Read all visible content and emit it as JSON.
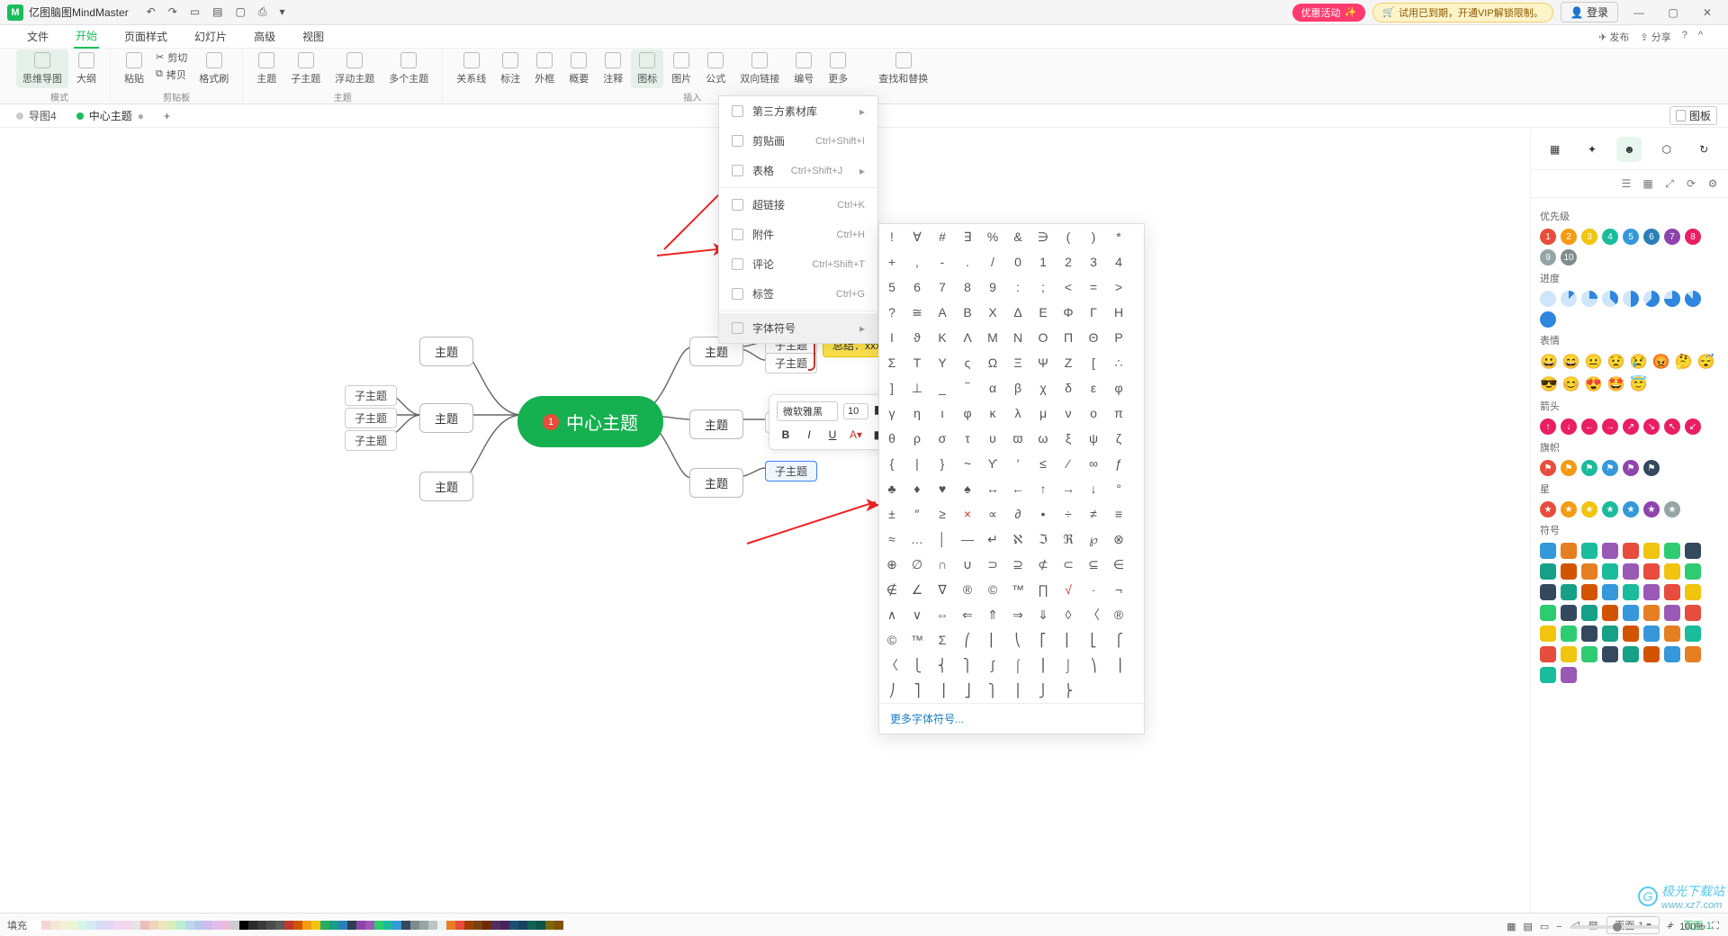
{
  "app": {
    "title": "亿图脑图MindMaster"
  },
  "titlebar": {
    "promo": "优惠活动",
    "vip": "试用已到期，开通VIP解锁限制。",
    "login": "登录"
  },
  "menu": {
    "items": [
      "文件",
      "开始",
      "页面样式",
      "幻灯片",
      "高级",
      "视图"
    ],
    "active": 1,
    "right": {
      "publish": "发布",
      "share": "分享"
    }
  },
  "ribbon": {
    "btns": [
      "思维导图",
      "大纲",
      "粘贴",
      "剪切",
      "拷贝",
      "格式刷",
      "主题",
      "子主题",
      "浮动主题",
      "多个主题",
      "关系线",
      "标注",
      "外框",
      "概要",
      "注释",
      "图标",
      "图片",
      "公式",
      "双向链接",
      "编号",
      "更多",
      "查找和替换"
    ],
    "groups": [
      "模式",
      "剪贴板",
      "主题",
      "插入"
    ]
  },
  "tabs": {
    "t1": "导图4",
    "t2": "中心主题",
    "right_toggle": "图板"
  },
  "mindmap": {
    "center": "中心主题",
    "center_badge": "1",
    "topic": "主题",
    "sub": "子主题",
    "summary": "总结：xxx"
  },
  "float_toolbar": {
    "font": "微软雅黑",
    "size": "10"
  },
  "dropdown": {
    "items": [
      {
        "label": "第三方素材库",
        "sub": true
      },
      {
        "label": "剪贴画",
        "shortcut": "Ctrl+Shift+I"
      },
      {
        "label": "表格",
        "shortcut": "Ctrl+Shift+J",
        "sub": true
      },
      {
        "label": "超链接",
        "shortcut": "Ctrl+K",
        "sep_before": true
      },
      {
        "label": "附件",
        "shortcut": "Ctrl+H"
      },
      {
        "label": "评论",
        "shortcut": "Ctrl+Shift+T"
      },
      {
        "label": "标签",
        "shortcut": "Ctrl+G"
      },
      {
        "label": "字体符号",
        "sub": true,
        "hov": true,
        "sep_before": true
      }
    ]
  },
  "symbols": {
    "rows": [
      [
        "!",
        "∀",
        "#",
        "∃",
        "%",
        "&",
        "∋",
        "(",
        ")",
        "*"
      ],
      [
        "+",
        ",",
        "-",
        ".",
        "/",
        "0",
        "1",
        "2",
        "3",
        "4"
      ],
      [
        "5",
        "6",
        "7",
        "8",
        "9",
        ":",
        ";",
        "<",
        "=",
        ">"
      ],
      [
        "?",
        "≅",
        "A",
        "B",
        "X",
        "Δ",
        "E",
        "Φ",
        "Γ",
        "H"
      ],
      [
        "I",
        "ϑ",
        "K",
        "Λ",
        "M",
        "N",
        "O",
        "Π",
        "Θ",
        "P"
      ],
      [
        "Σ",
        "T",
        "Y",
        "ς",
        "Ω",
        "Ξ",
        "Ψ",
        "Z",
        "[",
        "∴"
      ],
      [
        "]",
        "⊥",
        "_",
        "‾",
        "α",
        "β",
        "χ",
        "δ",
        "ε",
        "φ"
      ],
      [
        "γ",
        "η",
        "ι",
        "φ",
        "κ",
        "λ",
        "μ",
        "ν",
        "ο",
        "π"
      ],
      [
        "θ",
        "ρ",
        "σ",
        "τ",
        "υ",
        "ϖ",
        "ω",
        "ξ",
        "ψ",
        "ζ"
      ],
      [
        "{",
        "|",
        "}",
        "~",
        "ϒ",
        "′",
        "≤",
        "⁄",
        "∞",
        "ƒ"
      ],
      [
        "♣",
        "♦",
        "♥",
        "♠",
        "↔",
        "←",
        "↑",
        "→",
        "↓",
        "°"
      ],
      [
        "±",
        "″",
        "≥",
        "×",
        "∝",
        "∂",
        "•",
        "÷",
        "≠",
        "≡"
      ],
      [
        "≈",
        "…",
        "│",
        "—",
        "↵",
        "ℵ",
        "ℑ",
        "ℜ",
        "℘",
        "⊗"
      ],
      [
        "⊕",
        "∅",
        "∩",
        "∪",
        "⊃",
        "⊇",
        "⊄",
        "⊂",
        "⊆",
        "∈"
      ],
      [
        "∉",
        "∠",
        "∇",
        "®",
        "©",
        "™",
        "∏",
        "√",
        "·",
        "¬"
      ],
      [
        "∧",
        "∨",
        "⇔",
        "⇐",
        "⇑",
        "⇒",
        "⇓",
        "◊",
        "〈",
        "®"
      ],
      [
        "©",
        "™",
        "Σ",
        "⎛",
        "⎜",
        "⎝",
        "⎡",
        "⎢",
        "⎣",
        "⎧"
      ],
      [
        "〈",
        "⎩",
        "⎨",
        "⎫",
        "∫",
        "⌠",
        "⎮",
        "⌡",
        "⎞",
        "⎟"
      ],
      [
        "⎠",
        "⎤",
        "⎥",
        "⎦",
        "⎫",
        "⎪",
        "⎭",
        "⎬",
        "",
        ""
      ]
    ],
    "more": "更多字体符号..."
  },
  "rightpanel": {
    "sections": {
      "priority": "优先级",
      "progress": "进度",
      "emotion": "表情",
      "arrow": "箭头",
      "flag": "旗帜",
      "star": "星",
      "symbol": "符号"
    },
    "priority_colors": [
      "#e74c3c",
      "#f39c12",
      "#f1c40f",
      "#1abc9c",
      "#3498db",
      "#2980b9",
      "#8e44ad",
      "#e91e63",
      "#95a5a6",
      "#7f8c8d"
    ],
    "arrow_colors": [
      "#e91e63",
      "#e91e63",
      "#e91e63",
      "#e91e63",
      "#e91e63",
      "#e91e63",
      "#e91e63",
      "#e91e63"
    ],
    "flag_colors": [
      "#e74c3c",
      "#f39c12",
      "#1abc9c",
      "#3498db",
      "#8e44ad",
      "#34495e"
    ],
    "star_colors": [
      "#e74c3c",
      "#f39c12",
      "#f1c40f",
      "#1abc9c",
      "#3498db",
      "#8e44ad",
      "#95a5a6"
    ]
  },
  "status": {
    "fill": "填充",
    "page_label": "页面-1",
    "page_tab": "页面-1",
    "zoom": "100%"
  },
  "watermark": {
    "main": "极光下载站",
    "sub": "www.xz7.com"
  },
  "colorstrip": [
    "#ffffff",
    "#f5d6d6",
    "#f5e6d6",
    "#f5f0d6",
    "#eaf5d6",
    "#d6f5e6",
    "#d6eaf5",
    "#d6def5",
    "#e3d6f5",
    "#f0d6f5",
    "#f5d6ea",
    "#e6e6e6",
    "#edbcbc",
    "#edd6bc",
    "#ede6bc",
    "#d6edbc",
    "#bcedd6",
    "#bcd6ed",
    "#bcc6ed",
    "#cdbced",
    "#e3bced",
    "#edbcda",
    "#cccccc",
    "#000000",
    "#2b2b2b",
    "#3b3b3b",
    "#4b4b4b",
    "#5b5b5b",
    "#c0392b",
    "#d35400",
    "#f39c12",
    "#f1c40f",
    "#27ae60",
    "#16a085",
    "#2980b9",
    "#2c3e50",
    "#8e44ad",
    "#9b59b6",
    "#2ecc71",
    "#1abc9c",
    "#3498db",
    "#34495e",
    "#7f8c8d",
    "#95a5a6",
    "#bdc3c7",
    "#ecf0f1",
    "#e67e22",
    "#e74c3c",
    "#a04000",
    "#784212",
    "#6e2c00",
    "#512e5f",
    "#4a235a",
    "#1b4f72",
    "#154360",
    "#0e6251",
    "#0b5345",
    "#7d6608",
    "#7e5109"
  ]
}
